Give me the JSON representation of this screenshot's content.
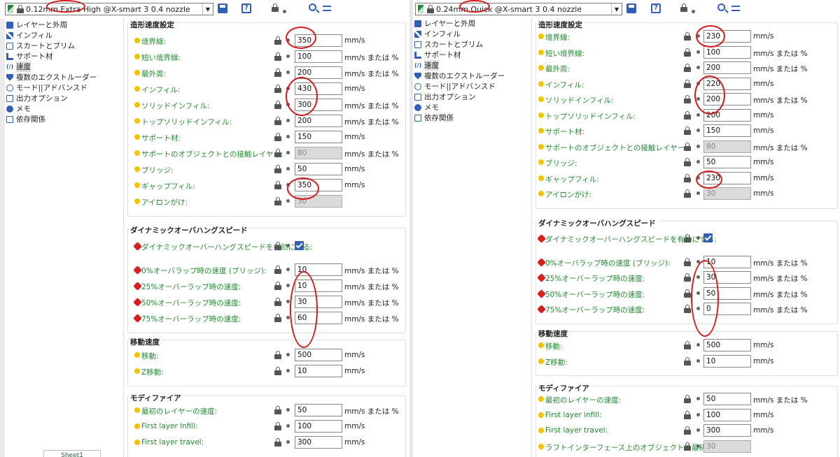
{
  "left": {
    "preset": "0.12mm Extra High @X-smart 3 0.4 nozzle",
    "sidebar": [
      "レイヤーと外周",
      "インフィル",
      "スカートとブリム",
      "サポート材",
      "速度",
      "複数のエクストルーダー",
      "モード||アドバンスド",
      "出力オプション",
      "メモ",
      "依存関係"
    ],
    "sections": {
      "print_speed": {
        "title": "造形速度設定",
        "rows": [
          {
            "label": "境界線:",
            "value": "350",
            "unit": "mm/s"
          },
          {
            "label": "短い境界線:",
            "value": "100",
            "unit": "mm/s または %"
          },
          {
            "label": "最外周:",
            "value": "200",
            "unit": "mm/s または %"
          },
          {
            "label": "インフィル:",
            "value": "430",
            "unit": "mm/s"
          },
          {
            "label": "ソリッドインフィル:",
            "value": "300",
            "unit": "mm/s または %"
          },
          {
            "label": "トップソリッドインフィル:",
            "value": "200",
            "unit": "mm/s または %"
          },
          {
            "label": "サポート材:",
            "value": "150",
            "unit": "mm/s"
          },
          {
            "label": "サポートのオブジェクトとの接触レイヤー:",
            "value": "80",
            "unit": "mm/s または %",
            "disabled": true
          },
          {
            "label": "ブリッジ:",
            "value": "50",
            "unit": "mm/s"
          },
          {
            "label": "ギャップフィル:",
            "value": "350",
            "unit": "mm/s"
          },
          {
            "label": "アイロンがけ:",
            "value": "30",
            "unit": "",
            "disabled": true
          }
        ]
      },
      "overhang": {
        "title": "ダイナミックオーバハングスピード",
        "enable_label": "ダイナミックオーバーハングスピードを有効にする:",
        "rows": [
          {
            "label": "0%オーバラップ時の速度 (ブリッジ):",
            "value": "10",
            "unit": "mm/s または %"
          },
          {
            "label": "25%オーバーラップ時の速度:",
            "value": "10",
            "unit": "mm/s または %"
          },
          {
            "label": "50%オーバーラップ時の速度:",
            "value": "30",
            "unit": "mm/s または %"
          },
          {
            "label": "75%オーバーラップ時の速度:",
            "value": "60",
            "unit": "mm/s または %"
          }
        ]
      },
      "travel": {
        "title": "移動速度",
        "rows": [
          {
            "label": "移動:",
            "value": "500",
            "unit": "mm/s"
          },
          {
            "label": "Z移動:",
            "value": "10",
            "unit": "mm/s"
          }
        ]
      },
      "modifiers": {
        "title": "モディファイア",
        "rows": [
          {
            "label": "最初のレイヤーの速度:",
            "value": "50",
            "unit": "mm/s または %"
          },
          {
            "label": "First layer infill:",
            "value": "100",
            "unit": "mm/s"
          },
          {
            "label": "First layer travel:",
            "value": "300",
            "unit": "mm/s"
          }
        ]
      }
    },
    "sheet_tab": "Sheet1"
  },
  "right": {
    "preset": "0.24mm Quick @X-smart 3 0.4 nozzle",
    "sidebar": [
      "レイヤーと外周",
      "インフィル",
      "スカートとブリム",
      "サポート材",
      "速度",
      "複数のエクストルーダー",
      "モード||アドバンスド",
      "出力オプション",
      "メモ",
      "依存関係"
    ],
    "sections": {
      "print_speed": {
        "title": "造形速度設定",
        "rows": [
          {
            "label": "境界線:",
            "value": "230",
            "unit": "mm/s"
          },
          {
            "label": "短い境界線:",
            "value": "100",
            "unit": "mm/s または %"
          },
          {
            "label": "最外周:",
            "value": "200",
            "unit": "mm/s または %"
          },
          {
            "label": "インフィル:",
            "value": "220",
            "unit": "mm/s"
          },
          {
            "label": "ソリッドインフィル:",
            "value": "200",
            "unit": "mm/s または %"
          },
          {
            "label": "トップソリッドインフィル:",
            "value": "200",
            "unit": "mm/s"
          },
          {
            "label": "サポート材:",
            "value": "150",
            "unit": "mm/s"
          },
          {
            "label": "サポートのオブジェクトとの接触レイヤー:",
            "value": "80",
            "unit": "mm/s または %",
            "disabled": true
          },
          {
            "label": "ブリッジ:",
            "value": "50",
            "unit": "mm/s"
          },
          {
            "label": "ギャップフィル:",
            "value": "230",
            "unit": "mm/s"
          },
          {
            "label": "アイロンがけ:",
            "value": "30",
            "unit": "mm/s",
            "disabled": true
          }
        ]
      },
      "overhang": {
        "title": "ダイナミックオーバハングスピード",
        "enable_label": "ダイナミックオーバーハングスピードを有効にする:",
        "rows": [
          {
            "label": "0%オーバラップ時の速度 (ブリッジ):",
            "value": "10",
            "unit": "mm/s または %"
          },
          {
            "label": "25%オーバーラップ時の速度:",
            "value": "30",
            "unit": "mm/s または %"
          },
          {
            "label": "50%オーバーラップ時の速度:",
            "value": "50",
            "unit": "mm/s または %"
          },
          {
            "label": "75%オーバーラップ時の速度:",
            "value": "0",
            "unit": "mm/s または %"
          }
        ]
      },
      "travel": {
        "title": "移動速度",
        "rows": [
          {
            "label": "移動:",
            "value": "500",
            "unit": "mm/s"
          },
          {
            "label": "Z移動:",
            "value": "10",
            "unit": "mm/s"
          }
        ]
      },
      "modifiers": {
        "title": "モディファイア",
        "rows": [
          {
            "label": "最初のレイヤーの速度:",
            "value": "50",
            "unit": "mm/s または %"
          },
          {
            "label": "First layer infill:",
            "value": "100",
            "unit": "mm/s"
          },
          {
            "label": "First layer travel:",
            "value": "300",
            "unit": "mm/s"
          },
          {
            "label": "ラフトインターフェース上のオブジェクトの最初のレイヤー:",
            "value": "30",
            "unit": "",
            "disabled": true
          }
        ]
      }
    }
  },
  "colors": {
    "label_green": "#1f8a2e",
    "bullet_yellow": "#f2c400",
    "bullet_red": "#d62020",
    "accent_blue": "#2f5fb8",
    "annotation_red": "#d41a1a"
  }
}
